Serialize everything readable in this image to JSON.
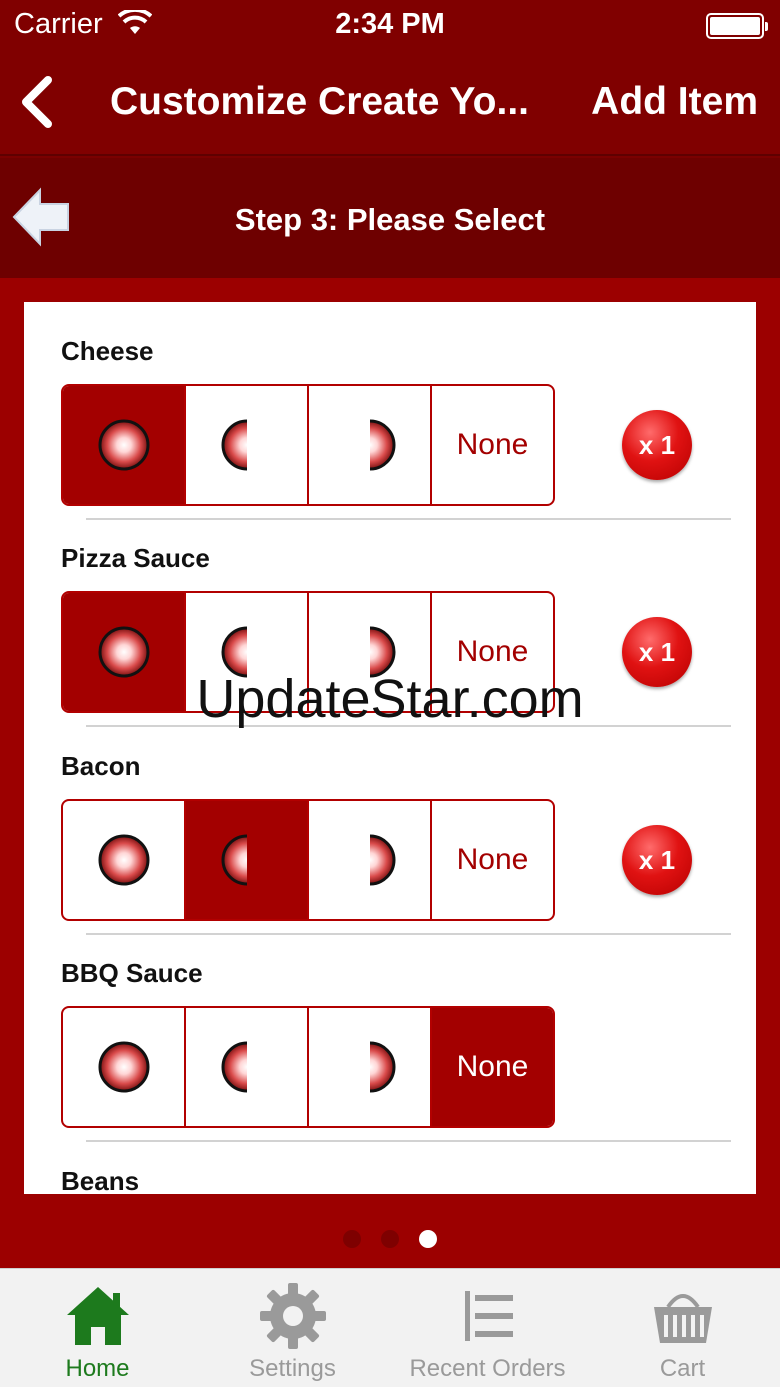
{
  "status_bar": {
    "carrier": "Carrier",
    "time": "2:34 PM"
  },
  "nav": {
    "title": "Customize Create Yo...",
    "action": "Add Item"
  },
  "step": {
    "title": "Step 3: Please Select"
  },
  "toppings": [
    {
      "name": "Cheese",
      "selected": "whole",
      "quantity": "x 1"
    },
    {
      "name": "Pizza Sauce",
      "selected": "whole",
      "quantity": "x 1"
    },
    {
      "name": "Bacon",
      "selected": "left",
      "quantity": "x 1"
    },
    {
      "name": "BBQ Sauce",
      "selected": "none"
    },
    {
      "name": "Beans"
    }
  ],
  "option_none_label": "None",
  "option_icons": [
    "whole-pizza-icon",
    "left-half-pizza-icon",
    "right-half-pizza-icon"
  ],
  "pagination": {
    "pages": 3,
    "current": 3
  },
  "tabs": [
    {
      "label": "Home",
      "icon": "home-icon",
      "active": true
    },
    {
      "label": "Settings",
      "icon": "gear-icon"
    },
    {
      "label": "Recent Orders",
      "icon": "list-icon"
    },
    {
      "label": "Cart",
      "icon": "basket-icon"
    }
  ],
  "watermark": "UpdateStar.com",
  "colors": {
    "primary": "#800000",
    "selected": "#a30000",
    "badge": "#e01212",
    "tab_active": "#1d7a1d"
  }
}
